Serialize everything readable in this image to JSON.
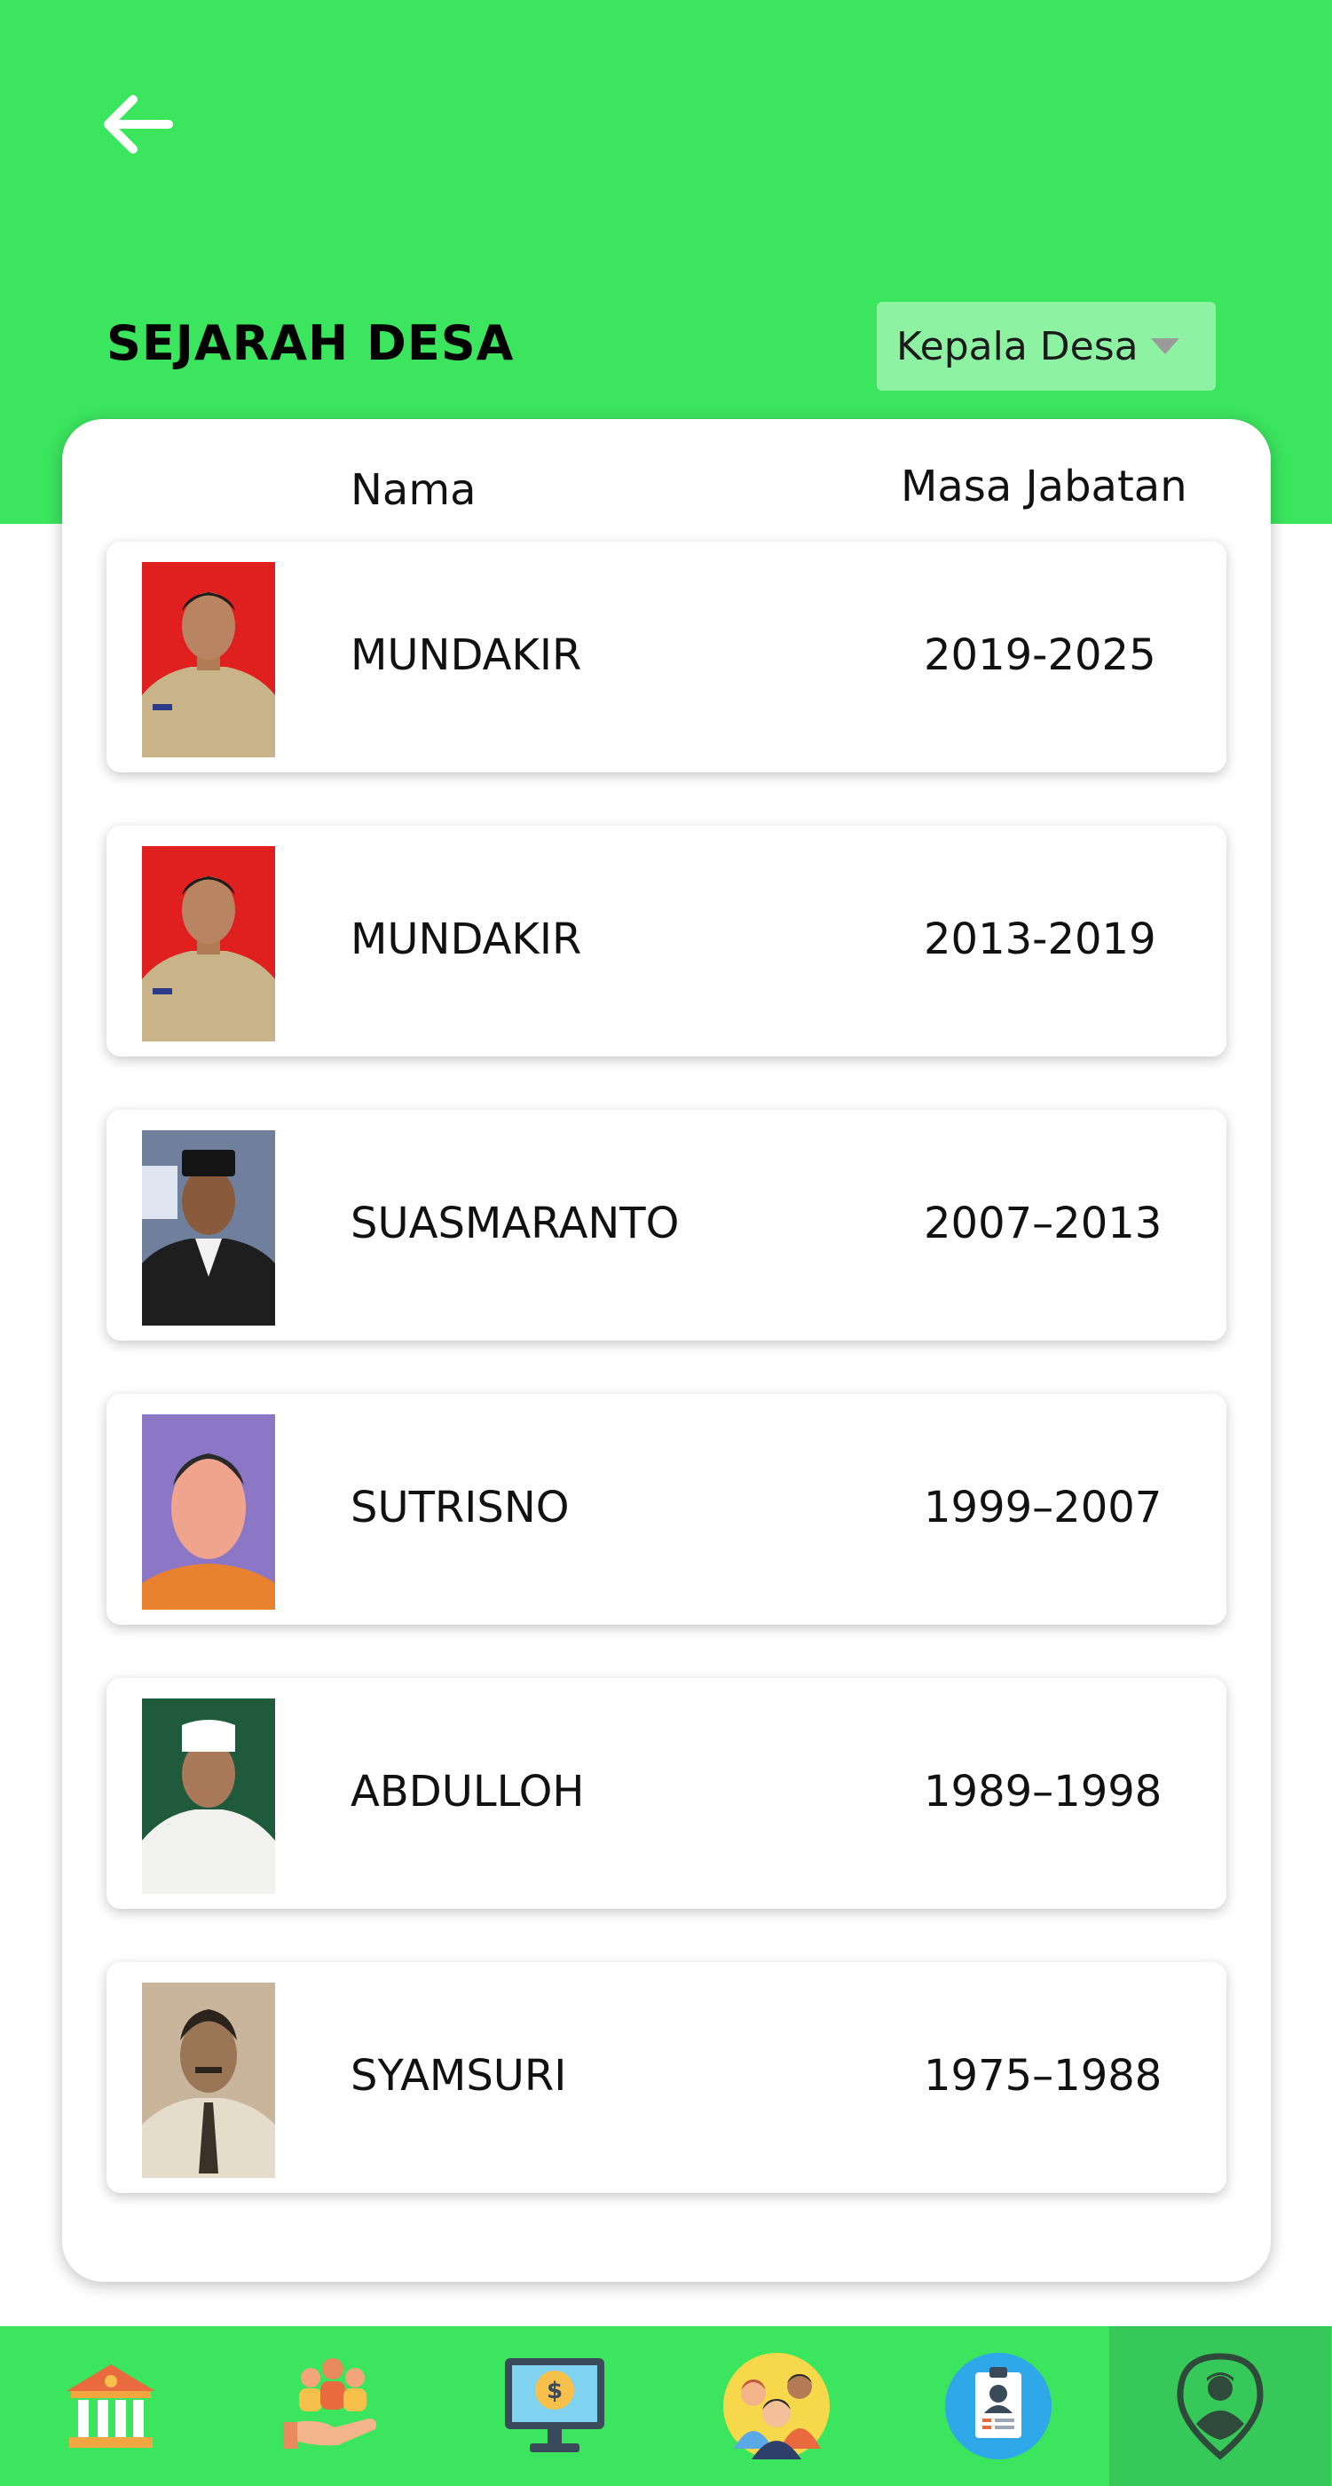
{
  "header": {
    "title": "SEJARAH DESA",
    "dropdown": {
      "selected": "Kepala Desa"
    }
  },
  "table": {
    "columns": {
      "name": "Nama",
      "term": "Masa Jabatan"
    },
    "rows": [
      {
        "name": "MUNDAKIR",
        "term": "2019-2025",
        "photo_bg": "#e01f1f"
      },
      {
        "name": "MUNDAKIR",
        "term": "2013-2019",
        "photo_bg": "#e01f1f"
      },
      {
        "name": "SUASMARANTO",
        "term": "2007–2013",
        "photo_bg": "#5b6a86"
      },
      {
        "name": "SUTRISNO",
        "term": "1999–2007",
        "photo_bg": "#8c76c6"
      },
      {
        "name": "ABDULLOH",
        "term": "1989–1998",
        "photo_bg": "#1f5a3d"
      },
      {
        "name": "SYAMSURI",
        "term": "1975–1988",
        "photo_bg": "#c8b59c"
      }
    ]
  },
  "bottom_nav": {
    "items": [
      {
        "icon": "government-building-icon"
      },
      {
        "icon": "community-hand-icon"
      },
      {
        "icon": "finance-monitor-icon"
      },
      {
        "icon": "officials-group-icon"
      },
      {
        "icon": "id-badge-icon"
      },
      {
        "icon": "village-head-location-icon",
        "active": true
      }
    ]
  },
  "colors": {
    "accent_green": "#3be55e",
    "dropdown_bg": "#8ef2a3",
    "active_nav": "#36c858"
  }
}
